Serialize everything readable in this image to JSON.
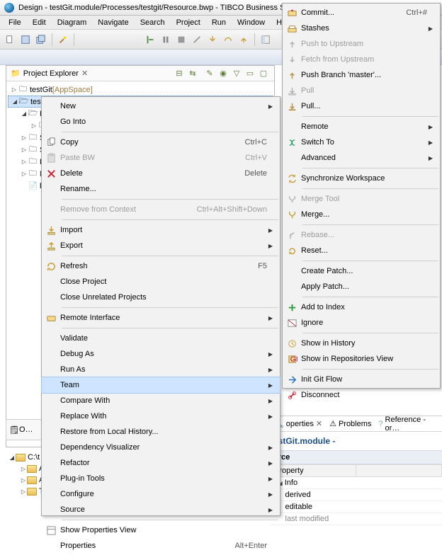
{
  "window": {
    "title": "Design - testGit.module/Processes/testgit/Resource.bwp - TIBCO Business Stud…"
  },
  "menubar": [
    "File",
    "Edit",
    "Diagram",
    "Navigate",
    "Search",
    "Project",
    "Run",
    "Window",
    "Help"
  ],
  "explorer": {
    "tab_label": "Project Explorer",
    "nodes": {
      "n0": "testGit",
      "n0_deco": "  [AppSpace]",
      "n1": "testGit.module",
      "n1_deco": "  [AppSpace]",
      "c0": "P",
      "c1": "S",
      "c2": "S",
      "c3": "P",
      "c4": "N",
      "c5": "b"
    }
  },
  "context_menu": {
    "items": [
      {
        "label": "New",
        "submenu": true
      },
      {
        "label": "Go Into"
      },
      {
        "sep": true
      },
      {
        "label": "Copy",
        "shortcut": "Ctrl+C",
        "icon": "copy"
      },
      {
        "label": "Paste BW",
        "shortcut": "Ctrl+V",
        "icon": "paste",
        "disabled": true
      },
      {
        "label": "Delete",
        "shortcut": "Delete",
        "icon": "delete"
      },
      {
        "label": "Rename..."
      },
      {
        "sep": true
      },
      {
        "label": "Remove from Context",
        "shortcut": "Ctrl+Alt+Shift+Down",
        "disabled": true
      },
      {
        "sep": true
      },
      {
        "label": "Import",
        "submenu": true,
        "icon": "import"
      },
      {
        "label": "Export",
        "submenu": true,
        "icon": "export"
      },
      {
        "sep": true
      },
      {
        "label": "Refresh",
        "shortcut": "F5",
        "icon": "refresh"
      },
      {
        "label": "Close Project"
      },
      {
        "label": "Close Unrelated Projects"
      },
      {
        "sep": true
      },
      {
        "label": "Remote Interface",
        "submenu": true,
        "icon": "remote"
      },
      {
        "sep": true
      },
      {
        "label": "Validate"
      },
      {
        "label": "Debug As",
        "submenu": true
      },
      {
        "label": "Run As",
        "submenu": true
      },
      {
        "label": "Team",
        "submenu": true,
        "hl": true
      },
      {
        "label": "Compare With",
        "submenu": true
      },
      {
        "label": "Replace With",
        "submenu": true
      },
      {
        "label": "Restore from Local History..."
      },
      {
        "label": "Dependency Visualizer",
        "submenu": true
      },
      {
        "label": "Refactor",
        "submenu": true
      },
      {
        "label": "Plug-in Tools",
        "submenu": true
      },
      {
        "label": "Configure",
        "submenu": true
      },
      {
        "label": "Source",
        "submenu": true
      },
      {
        "sep": true
      },
      {
        "label": "Show Properties View",
        "icon": "propview"
      },
      {
        "label": "Properties",
        "shortcut": "Alt+Enter"
      }
    ]
  },
  "team_submenu": {
    "items": [
      {
        "label": "Commit...",
        "shortcut": "Ctrl+#",
        "icon": "commit"
      },
      {
        "label": "Stashes",
        "submenu": true,
        "icon": "stash"
      },
      {
        "label": "Push to Upstream",
        "icon": "push",
        "disabled": true
      },
      {
        "label": "Fetch from Upstream",
        "icon": "fetch",
        "disabled": true
      },
      {
        "label": "Push Branch 'master'...",
        "icon": "push"
      },
      {
        "label": "Pull",
        "icon": "pull",
        "disabled": true
      },
      {
        "label": "Pull...",
        "icon": "pull"
      },
      {
        "sep": true
      },
      {
        "label": "Remote",
        "submenu": true
      },
      {
        "label": "Switch To",
        "submenu": true,
        "icon": "switch"
      },
      {
        "label": "Advanced",
        "submenu": true
      },
      {
        "sep": true
      },
      {
        "label": "Synchronize Workspace",
        "icon": "sync"
      },
      {
        "sep": true
      },
      {
        "label": "Merge Tool",
        "icon": "mergetool",
        "disabled": true
      },
      {
        "label": "Merge...",
        "icon": "merge"
      },
      {
        "sep": true
      },
      {
        "label": "Rebase...",
        "icon": "rebase",
        "disabled": true
      },
      {
        "label": "Reset...",
        "icon": "reset"
      },
      {
        "sep": true
      },
      {
        "label": "Create Patch..."
      },
      {
        "label": "Apply Patch..."
      },
      {
        "sep": true
      },
      {
        "label": "Add to Index",
        "icon": "add"
      },
      {
        "label": "Ignore",
        "icon": "ignore"
      },
      {
        "sep": true
      },
      {
        "label": "Show in History",
        "icon": "history"
      },
      {
        "label": "Show in Repositories View",
        "icon": "repo"
      },
      {
        "sep": true
      },
      {
        "label": "Init Git Flow",
        "icon": "gitflow"
      },
      {
        "label": "Disconnect",
        "icon": "disconnect"
      }
    ]
  },
  "outline_label": "O…",
  "lower_tree": {
    "root": "C:\\t",
    "children": [
      "A",
      "A",
      "T"
    ]
  },
  "right_panel": {
    "tabs": [
      "operties",
      "Problems",
      "Reference - or…"
    ],
    "title": "estGit.module -",
    "section": "urce",
    "header": "Property",
    "group": "Info",
    "rows": [
      "derived",
      "editable",
      "last modified"
    ]
  }
}
